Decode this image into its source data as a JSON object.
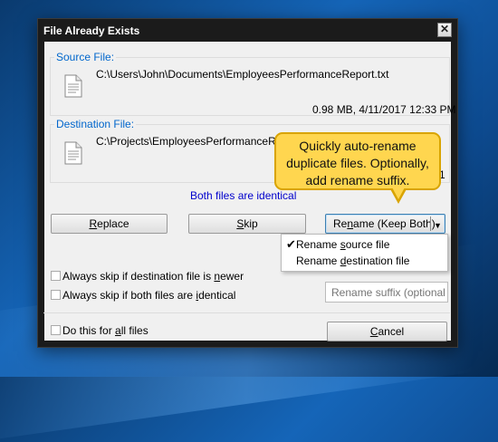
{
  "window": {
    "title": "File Already Exists",
    "close_glyph": "✕"
  },
  "source": {
    "label": "Source File:",
    "path": "C:\\Users\\John\\Documents\\EmployeesPerformanceReport.txt",
    "meta": "0.98 MB, 4/11/2017 12:33 PM",
    "icon": "document-icon"
  },
  "destination": {
    "label": "Destination File:",
    "path": "C:\\Projects\\EmployeesPerformanceReport",
    "meta_fragment": "1",
    "icon": "document-icon"
  },
  "identical_text": "Both files are identical",
  "buttons": {
    "replace": {
      "pre": "",
      "mnemonic": "R",
      "post": "eplace"
    },
    "skip": {
      "pre": "",
      "mnemonic": "S",
      "post": "kip"
    },
    "rename": {
      "pre": "Re",
      "mnemonic": "n",
      "post": "ame (Keep Both)"
    },
    "rename_arrow": "▼",
    "cancel": {
      "pre": "",
      "mnemonic": "C",
      "post": "ancel"
    }
  },
  "rename_menu": {
    "check_glyph": "✔",
    "items": [
      {
        "pre": "Rename ",
        "mnemonic": "s",
        "post": "ource file",
        "checked": true
      },
      {
        "pre": "Rename ",
        "mnemonic": "d",
        "post": "estination file",
        "checked": false
      }
    ]
  },
  "options": {
    "skip_newer": {
      "pre": "Always skip if destination file is ",
      "mnemonic": "n",
      "post": "ewer",
      "checked": false
    },
    "skip_identical": {
      "pre": "Always skip if both files are ",
      "mnemonic": "i",
      "post": "dentical",
      "checked": false
    },
    "do_all": {
      "pre": "Do this for ",
      "mnemonic": "a",
      "post": "ll files",
      "checked": false
    }
  },
  "rename_suffix": {
    "placeholder": "Rename suffix (optional)",
    "value": ""
  },
  "callout": {
    "lines": [
      "Quickly auto-rename",
      "duplicate files. Optionally,",
      "add rename suffix."
    ],
    "color": "#ffd64f"
  },
  "colors": {
    "group_label": "#0066cc",
    "identical": "#0000cc"
  }
}
